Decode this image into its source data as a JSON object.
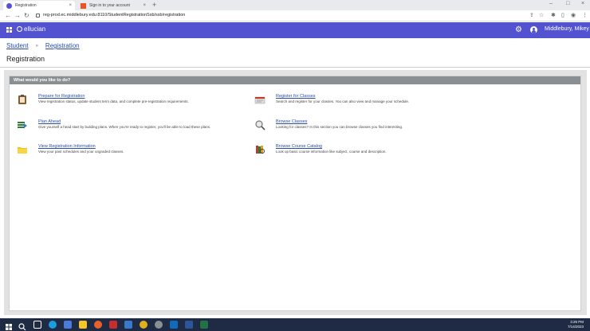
{
  "browser": {
    "tabs": [
      {
        "title": "Registration",
        "close": "×"
      },
      {
        "title": "Sign in to your account",
        "close": "×"
      }
    ],
    "new_tab": "+",
    "window_controls": [
      "–",
      "□",
      "×"
    ],
    "nav": {
      "back": "←",
      "forward": "→",
      "reload": "↻"
    },
    "url": "reg-prod.ec.middlebury.edu:8110/StudentRegistrationSsb/ssb/registration",
    "toolbar_icons": [
      "share-icon",
      "star-icon",
      "extensions-icon",
      "sidebar-icon",
      "profile-icon",
      "menu-icon"
    ],
    "toolbar_glyphs": [
      "⇪",
      "☆",
      "✱",
      "▯",
      "◉",
      "⋮"
    ]
  },
  "app": {
    "brand": "ellucian",
    "gear": "⚙",
    "user": "Middlebury, Mikey"
  },
  "breadcrumb": {
    "items": [
      "Student",
      "Registration"
    ],
    "separator": "»"
  },
  "page": {
    "title": "Registration"
  },
  "panel": {
    "heading": "What would you like to do?",
    "items": [
      {
        "link": "Prepare for Registration",
        "description": "View registration status, update student term data, and complete pre-registration requirements.",
        "icon": "clipboard-icon"
      },
      {
        "link": "Register for Classes",
        "description": "Search and register for your classes. You can also view and manage your schedule.",
        "icon": "register-icon"
      },
      {
        "link": "Plan Ahead",
        "description": "Give yourself a head start by building plans. When you're ready to register, you'll be able to load these plans.",
        "icon": "plan-icon"
      },
      {
        "link": "Browse Classes",
        "description": "Looking for classes? In this section you can browse classes you find interesting.",
        "icon": "magnifier-icon"
      },
      {
        "link": "View Registration Information",
        "description": "View your past schedules and your ungraded classes.",
        "icon": "folder-icon"
      },
      {
        "link": "Browse Course Catalog",
        "description": "Look up basic course information like subject, course and description.",
        "icon": "catalog-icon"
      }
    ]
  },
  "taskbar": {
    "time": "3:26 PM",
    "date": "7/14/2023",
    "apps": [
      "windows-icon",
      "search-icon",
      "taskview-icon",
      "edge-icon",
      "widgets-icon",
      "file-explorer-icon",
      "firefox-icon",
      "app-icon",
      "chrome-icon",
      "settings-icon",
      "outlook-icon",
      "word-icon",
      "excel-icon"
    ]
  },
  "colors": {
    "header": "#5353d1",
    "panel_head": "#8a8f93",
    "link": "#2b4da6",
    "taskbar": "#1f2a44"
  }
}
